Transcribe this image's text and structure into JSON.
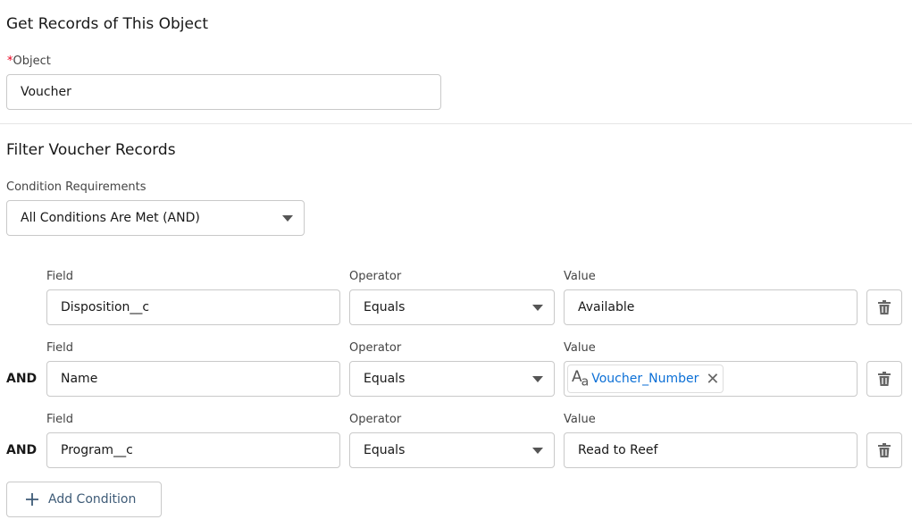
{
  "section1": {
    "title": "Get Records of This Object",
    "object_label": "Object",
    "required_mark": "*",
    "object_value": "Voucher"
  },
  "section2": {
    "title": "Filter Voucher Records",
    "condition_label": "Condition Requirements",
    "condition_value": "All Conditions Are Met (AND)"
  },
  "conditions": [
    {
      "connector": "",
      "field_label": "Field",
      "field": "Disposition__c",
      "operator_label": "Operator",
      "operator": "Equals",
      "value_label": "Value",
      "value": "Available"
    },
    {
      "connector": "AND",
      "field_label": "Field",
      "field": "Name",
      "operator_label": "Operator",
      "operator": "Equals",
      "value_label": "Value",
      "value": "Voucher_Number",
      "value_is_resource": true
    },
    {
      "connector": "AND",
      "field_label": "Field",
      "field": "Program__c",
      "operator_label": "Operator",
      "operator": "Equals",
      "value_label": "Value",
      "value": "Read to Reef"
    }
  ],
  "add_condition_label": "Add Condition",
  "colors": {
    "required": "#ea001e",
    "resource_link": "#0b6fd6",
    "button_text": "#3e5b77"
  }
}
